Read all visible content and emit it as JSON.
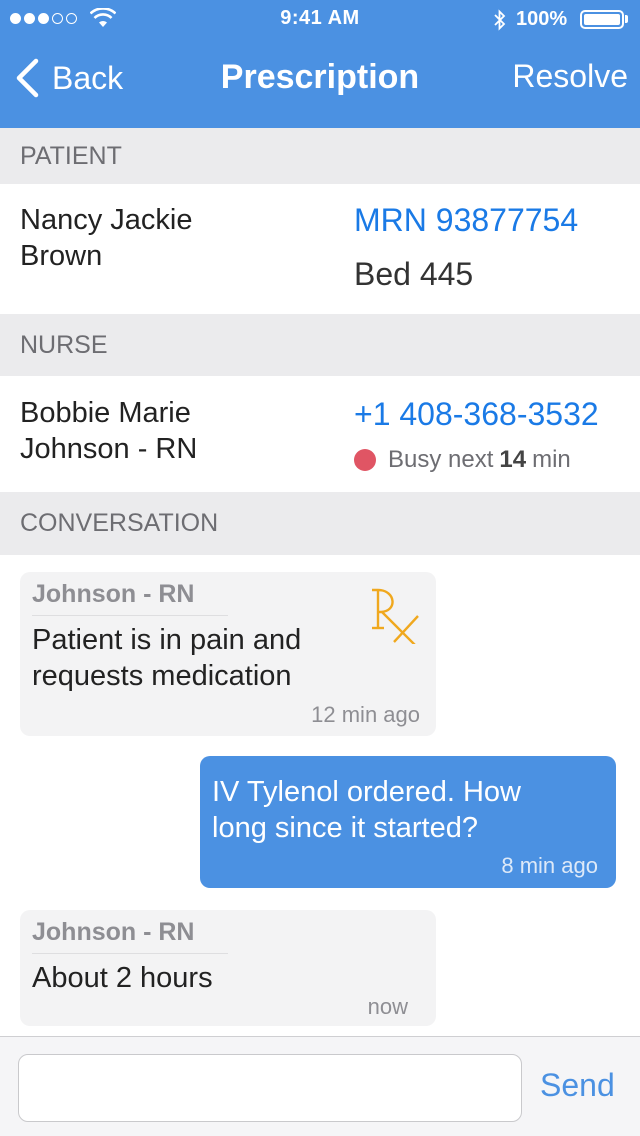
{
  "status_bar": {
    "time": "9:41 AM",
    "battery": "100%",
    "signal_bars_filled": 3,
    "signal_bars_total": 5
  },
  "nav": {
    "back_label": "Back",
    "title": "Prescription",
    "resolve_label": "Resolve"
  },
  "patient": {
    "section_title": "PATIENT",
    "name_line1": "Nancy Jackie",
    "name_line2": "Brown",
    "mrn": "MRN 93877754",
    "bed": "Bed 445"
  },
  "nurse": {
    "section_title": "NURSE",
    "name_line1": "Bobbie Marie",
    "name_line2": "Johnson - RN",
    "phone": "+1 408-368-3532",
    "busy_prefix": "Busy next",
    "busy_value": "14",
    "busy_unit": "min"
  },
  "conversation": {
    "section_title": "CONVERSATION",
    "messages": [
      {
        "sender": "Johnson - RN",
        "line1": "Patient is in pain and",
        "line2": "requests medication",
        "time": "12 min ago",
        "icon": "rx-icon"
      },
      {
        "line1": "IV Tylenol ordered. How",
        "line2": "long since it started?",
        "time": "8 min ago"
      },
      {
        "sender": "Johnson - RN",
        "line1": "About 2 hours",
        "time": "now"
      }
    ]
  },
  "composer": {
    "input_value": "",
    "placeholder": "",
    "send_label": "Send"
  },
  "colors": {
    "accent": "#4b91e2",
    "link": "#1a7ae6",
    "busy": "#e05564",
    "rx": "#f0a81e",
    "section_bg": "#ebebed"
  }
}
